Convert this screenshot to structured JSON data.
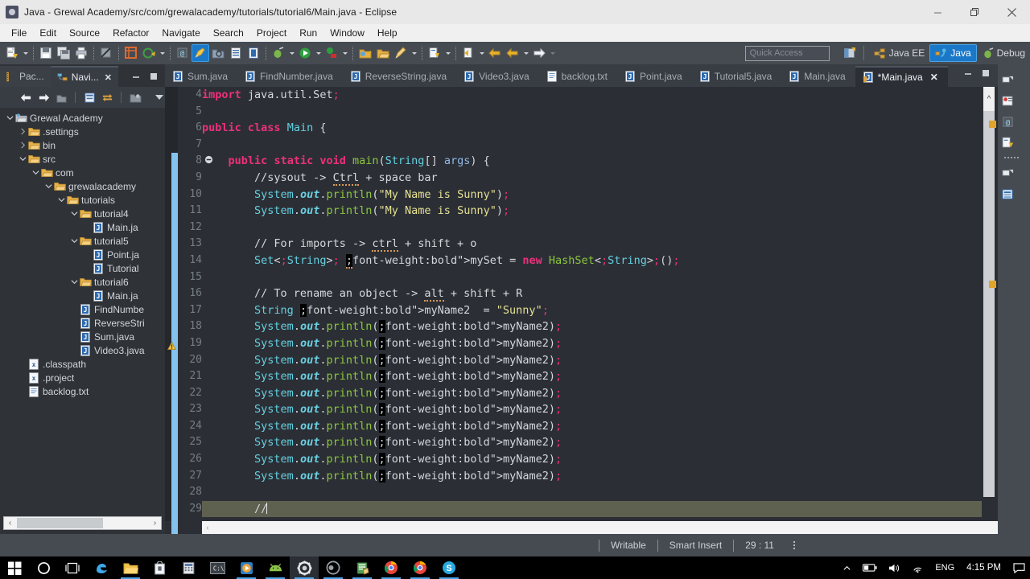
{
  "window": {
    "title": "Java - Grewal Academy/src/com/grewalacademy/tutorials/tutorial6/Main.java - Eclipse",
    "app_icon": "eclipse-icon",
    "minimize": "minimize-icon",
    "maximize": "restore-icon",
    "close": "close-icon"
  },
  "menubar": {
    "items": [
      "File",
      "Edit",
      "Source",
      "Refactor",
      "Navigate",
      "Search",
      "Project",
      "Run",
      "Window",
      "Help"
    ]
  },
  "toolbar": {
    "quick_access_placeholder": "Quick Access",
    "perspectives": [
      {
        "label": "Java EE",
        "icon": "java-ee-perspective-icon",
        "active": false
      },
      {
        "label": "Java",
        "icon": "java-perspective-icon",
        "active": true
      },
      {
        "label": "Debug",
        "icon": "debug-perspective-icon",
        "active": false
      }
    ],
    "open_perspective_icon": "open-perspective-icon"
  },
  "sidebar": {
    "tabs": [
      {
        "label": "Pac...",
        "icon": "package-explorer-icon",
        "active": false,
        "closable": false
      },
      {
        "label": "Navi...",
        "icon": "navigator-icon",
        "active": true,
        "closable": true
      }
    ],
    "minimize_icon": "minimize-view-icon",
    "maximize_icon": "maximize-view-icon",
    "view_toolbar": [
      "back-icon",
      "forward-icon",
      "home-icon",
      "collapse-all-icon",
      "link-with-editor-icon",
      "filter-icon",
      "view-menu-icon"
    ],
    "tree": [
      {
        "label": "Grewal Academy",
        "depth": 0,
        "icon": "project-folder-icon",
        "twisty": "open"
      },
      {
        "label": ".settings",
        "depth": 1,
        "icon": "folder-icon",
        "twisty": "closed"
      },
      {
        "label": "bin",
        "depth": 1,
        "icon": "folder-icon",
        "twisty": "closed"
      },
      {
        "label": "src",
        "depth": 1,
        "icon": "folder-icon",
        "twisty": "open"
      },
      {
        "label": "com",
        "depth": 2,
        "icon": "folder-icon",
        "twisty": "open"
      },
      {
        "label": "grewalacademy",
        "depth": 3,
        "icon": "folder-icon",
        "twisty": "open"
      },
      {
        "label": "tutorials",
        "depth": 4,
        "icon": "folder-icon",
        "twisty": "open"
      },
      {
        "label": "tutorial4",
        "depth": 5,
        "icon": "folder-icon",
        "twisty": "open"
      },
      {
        "label": "Main.ja",
        "depth": 6,
        "icon": "java-file-icon",
        "twisty": "none"
      },
      {
        "label": "tutorial5",
        "depth": 5,
        "icon": "folder-icon",
        "twisty": "open"
      },
      {
        "label": "Point.ja",
        "depth": 6,
        "icon": "java-file-icon",
        "twisty": "none"
      },
      {
        "label": "Tutorial",
        "depth": 6,
        "icon": "java-file-icon",
        "twisty": "none"
      },
      {
        "label": "tutorial6",
        "depth": 5,
        "icon": "folder-icon",
        "twisty": "open"
      },
      {
        "label": "Main.ja",
        "depth": 6,
        "icon": "java-file-icon",
        "twisty": "none"
      },
      {
        "label": "FindNumbe",
        "depth": 5,
        "icon": "java-file-icon",
        "twisty": "none"
      },
      {
        "label": "ReverseStri",
        "depth": 5,
        "icon": "java-file-icon",
        "twisty": "none"
      },
      {
        "label": "Sum.java",
        "depth": 5,
        "icon": "java-file-icon",
        "twisty": "none"
      },
      {
        "label": "Video3.java",
        "depth": 5,
        "icon": "java-file-icon",
        "twisty": "none"
      },
      {
        "label": ".classpath",
        "depth": 1,
        "icon": "xml-file-icon",
        "twisty": "none"
      },
      {
        "label": ".project",
        "depth": 1,
        "icon": "xml-file-icon",
        "twisty": "none"
      },
      {
        "label": "backlog.txt",
        "depth": 1,
        "icon": "text-file-icon",
        "twisty": "none"
      }
    ]
  },
  "editor": {
    "tabs": [
      {
        "label": "Sum.java",
        "icon": "java-file-icon",
        "active": false,
        "dirty": false
      },
      {
        "label": "FindNumber.java",
        "icon": "java-file-icon",
        "active": false,
        "dirty": false
      },
      {
        "label": "ReverseString.java",
        "icon": "java-file-icon",
        "active": false,
        "dirty": false
      },
      {
        "label": "Video3.java",
        "icon": "java-file-icon",
        "active": false,
        "dirty": false
      },
      {
        "label": "backlog.txt",
        "icon": "text-file-icon",
        "active": false,
        "dirty": false
      },
      {
        "label": "Point.java",
        "icon": "java-file-icon",
        "active": false,
        "dirty": false
      },
      {
        "label": "Tutorial5.java",
        "icon": "java-file-icon",
        "active": false,
        "dirty": false
      },
      {
        "label": "Main.java",
        "icon": "java-file-icon",
        "active": false,
        "dirty": false
      },
      {
        "label": "*Main.java",
        "icon": "java-file-dirty-icon",
        "active": true,
        "dirty": true
      }
    ],
    "minimize_icon": "minimize-view-icon",
    "maximize_icon": "maximize-view-icon",
    "first_line_number": 4,
    "lines": [
      {
        "n": 4,
        "text": "import java.util.Set;"
      },
      {
        "n": 5,
        "text": ""
      },
      {
        "n": 6,
        "text": "public class Main {"
      },
      {
        "n": 7,
        "text": ""
      },
      {
        "n": 8,
        "text": "    public static void main(String[] args) {",
        "folding": "collapse"
      },
      {
        "n": 9,
        "text": "        //sysout -> Ctrl + space bar"
      },
      {
        "n": 10,
        "text": "        System.out.println(\"My Name is Sunny\");"
      },
      {
        "n": 11,
        "text": "        System.out.println(\"My Name is Sunny\");"
      },
      {
        "n": 12,
        "text": ""
      },
      {
        "n": 13,
        "text": "        // For imports -> ctrl + shift + o"
      },
      {
        "n": 14,
        "text": "        Set<String> mySet = new HashSet<String>();",
        "marker": "warning"
      },
      {
        "n": 15,
        "text": ""
      },
      {
        "n": 16,
        "text": "        // To rename an object -> alt + shift + R"
      },
      {
        "n": 17,
        "text": "        String myName2  = \"Sunny\";"
      },
      {
        "n": 18,
        "text": "        System.out.println(myName2);"
      },
      {
        "n": 19,
        "text": "        System.out.println(myName2);"
      },
      {
        "n": 20,
        "text": "        System.out.println(myName2);"
      },
      {
        "n": 21,
        "text": "        System.out.println(myName2);"
      },
      {
        "n": 22,
        "text": "        System.out.println(myName2);"
      },
      {
        "n": 23,
        "text": "        System.out.println(myName2);"
      },
      {
        "n": 24,
        "text": "        System.out.println(myName2);"
      },
      {
        "n": 25,
        "text": "        System.out.println(myName2);"
      },
      {
        "n": 26,
        "text": "        System.out.println(myName2);"
      },
      {
        "n": 27,
        "text": "        System.out.println(myName2);"
      },
      {
        "n": 28,
        "text": ""
      },
      {
        "n": 29,
        "text": "        //",
        "current": true
      }
    ],
    "colors": {
      "background": "#2b2f35",
      "keyword": "#ef2f7c",
      "string": "#e5e093",
      "comment": "#d6d9dc",
      "type": "#64cfe0",
      "method": "#8dc63f",
      "field": "#7fd3e3",
      "parameter": "#8fb8e8",
      "current_line": "#5f6150",
      "change_bar": "#85c3ef",
      "occurrence": "#000000"
    }
  },
  "statusbar": {
    "writable": "Writable",
    "insert_mode": "Smart Insert",
    "position": "29 : 11"
  },
  "taskbar": {
    "items": [
      {
        "name": "start-button",
        "icon": "windows-logo-icon",
        "running": false,
        "active": false
      },
      {
        "name": "cortana-button",
        "icon": "cortana-circle-icon",
        "running": false,
        "active": false
      },
      {
        "name": "task-view-button",
        "icon": "task-view-icon",
        "running": false,
        "active": false
      },
      {
        "name": "edge-button",
        "icon": "edge-icon",
        "running": false,
        "active": false
      },
      {
        "name": "file-explorer-button",
        "icon": "folder-icon",
        "running": true,
        "active": false
      },
      {
        "name": "store-button",
        "icon": "store-icon",
        "running": false,
        "active": false
      },
      {
        "name": "calculator-button",
        "icon": "calculator-icon",
        "running": false,
        "active": false
      },
      {
        "name": "terminal-button",
        "icon": "command-prompt-icon",
        "running": false,
        "active": false
      },
      {
        "name": "media-player-button",
        "icon": "media-player-icon",
        "running": true,
        "active": false
      },
      {
        "name": "android-studio-button",
        "icon": "android-icon",
        "running": true,
        "active": false
      },
      {
        "name": "eclipse-button",
        "icon": "eclipse-gear-icon",
        "running": true,
        "active": true
      },
      {
        "name": "obs-button",
        "icon": "obs-icon",
        "running": true,
        "active": false
      },
      {
        "name": "notepad-button",
        "icon": "notepad-icon",
        "running": true,
        "active": false
      },
      {
        "name": "chrome-button-1",
        "icon": "chrome-icon",
        "running": true,
        "active": false
      },
      {
        "name": "chrome-button-2",
        "icon": "chrome-icon",
        "running": true,
        "active": false
      },
      {
        "name": "skype-button",
        "icon": "skype-icon",
        "running": true,
        "active": false
      }
    ],
    "tray": {
      "show_hidden": "chevron-up-icon",
      "battery": "battery-icon",
      "volume": "speaker-icon",
      "network": "wifi-icon",
      "language": "ENG",
      "clock": "4:15 PM",
      "action_center": "action-center-icon"
    }
  }
}
